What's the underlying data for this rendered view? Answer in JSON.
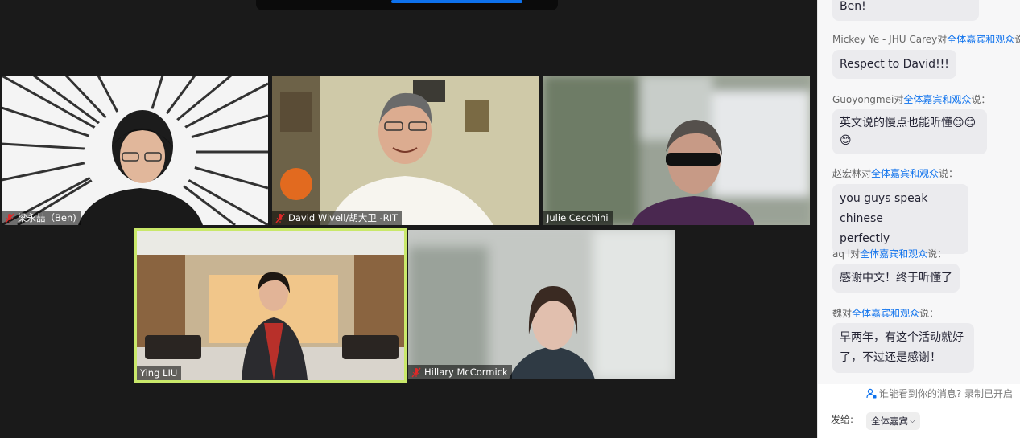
{
  "participants": [
    {
      "name": "梁永喆（Ben)",
      "muted": true
    },
    {
      "name": "David Wivell/胡大卫 -RIT",
      "muted": true
    },
    {
      "name": "Julie Cecchini",
      "muted": false
    },
    {
      "name": "Ying LIU",
      "muted": false,
      "active_speaker": true
    },
    {
      "name": "Hillary McCormick",
      "muted": true
    }
  ],
  "chat": {
    "messages": [
      {
        "sender": "",
        "to_label": "",
        "said": "",
        "text": "Ben!"
      },
      {
        "sender": "Mickey Ye - JHU Carey",
        "to_label": "全体嘉宾和观众",
        "said": "说",
        "text": "Respect to David!!!"
      },
      {
        "sender": "Guoyongmei",
        "to_label": "全体嘉宾和观众",
        "said": "说：",
        "text_line1": "英文说的慢点也能听懂😊😊",
        "text_line2": "😊"
      },
      {
        "sender": "赵宏林",
        "to_label": "全体嘉宾和观众",
        "said": "说：",
        "text_line1": "you guys speak chinese",
        "text_line2": "perfectly"
      },
      {
        "sender": "aq l",
        "to_label": "全体嘉宾和观众",
        "said": "说：",
        "text": "感谢中文！终于听懂了"
      },
      {
        "sender": "魏",
        "to_label": "全体嘉宾和观众",
        "said": "说：",
        "text_line1": "早两年，有这个活动就好",
        "text_line2": "了，不过还是感谢！"
      }
    ],
    "to_word": "对",
    "notice": "谁能看到你的消息? 录制已开启",
    "send_to_label": "发给:",
    "recipient": "全体嘉宾"
  },
  "colors": {
    "accent": "#0e72ed",
    "active_border": "#c9e86a",
    "muted_red": "#e02828"
  }
}
